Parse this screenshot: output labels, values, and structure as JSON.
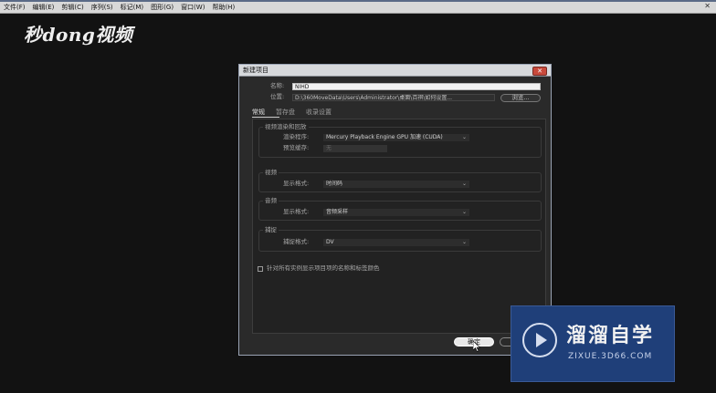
{
  "menubar": {
    "items": [
      "文件(F)",
      "编辑(E)",
      "剪辑(C)",
      "序列(S)",
      "标记(M)",
      "图形(G)",
      "窗口(W)",
      "帮助(H)"
    ],
    "close": "✕"
  },
  "watermark_top": "秒dong视频",
  "dialog": {
    "title": "新建项目",
    "close": "✕",
    "name_label": "名称:",
    "name_value": "NIHD",
    "location_label": "位置:",
    "location_value": "D:\\360MoveData\\Users\\Administrator\\桌面\\百祺\\如何设置...",
    "browse": "浏览...",
    "tabs": [
      "常规",
      "暂存盘",
      "收录设置"
    ],
    "sections": {
      "render": {
        "title": "视频渲染和回放",
        "renderer_label": "渲染程序:",
        "renderer_value": "Mercury Playback Engine GPU 加速 (CUDA)",
        "preview_cache_label": "预览缓存:",
        "preview_cache_value": "无"
      },
      "video": {
        "title": "视频",
        "display_format_label": "显示格式:",
        "display_format_value": "时间码"
      },
      "audio": {
        "title": "音频",
        "display_format_label": "显示格式:",
        "display_format_value": "音频采样"
      },
      "capture": {
        "title": "捕捉",
        "capture_format_label": "捕捉格式:",
        "capture_format_value": "DV"
      }
    },
    "checkbox_label": "针对所有实例显示项目项的名称和标签颜色",
    "ok": "确定"
  },
  "watermark_box": {
    "brand": "溜溜自学",
    "url": "ZIXUE.3D66.COM"
  }
}
